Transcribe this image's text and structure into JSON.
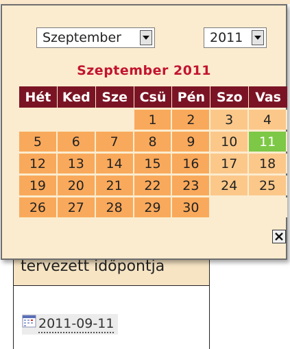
{
  "calendar": {
    "month_select": "Szeptember",
    "year_select": "2011",
    "title": "Szeptember 2011",
    "weekdays": [
      "Hét",
      "Ked",
      "Sze",
      "Csü",
      "Pén",
      "Szo",
      "Vas"
    ],
    "weeks": [
      [
        "",
        "",
        "",
        "1",
        "2",
        "3",
        "4"
      ],
      [
        "5",
        "6",
        "7",
        "8",
        "9",
        "10",
        "11"
      ],
      [
        "12",
        "13",
        "14",
        "15",
        "16",
        "17",
        "18"
      ],
      [
        "19",
        "20",
        "21",
        "22",
        "23",
        "24",
        "25"
      ],
      [
        "26",
        "27",
        "28",
        "29",
        "30",
        "",
        ""
      ]
    ],
    "selected_day": "11",
    "close_label": "✕"
  },
  "form": {
    "section_heading_fragment": "tervezett időpontja",
    "date_value": "2011-09-11"
  },
  "colors": {
    "weekday_header": "#7a1424",
    "weekday_cell": "#f9a95b",
    "weekend_cell": "#fbc88a",
    "selected_cell": "#7dc846",
    "title": "#c2142f",
    "popup_bg": "#fbeccf"
  }
}
